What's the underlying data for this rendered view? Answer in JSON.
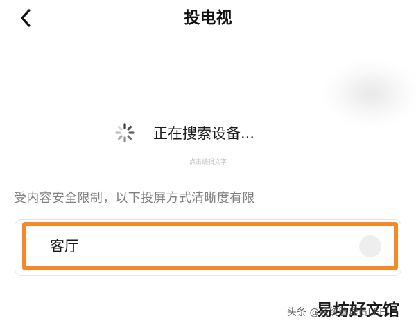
{
  "header": {
    "title": "投电视",
    "back_icon": "chevron-left-icon"
  },
  "search": {
    "status_text": "正在搜索设备...",
    "edit_hint": "点击编辑文字",
    "spinner_icon": "loading-spinner-icon"
  },
  "notice": "受内容安全限制，以下投屏方式清晰度有限",
  "devices": [
    {
      "name": "客厅",
      "selected": false
    }
  ],
  "colors": {
    "highlight": "#f5892a",
    "notice_text": "#7f7f7f",
    "card_border": "#e6e6e6"
  },
  "watermark": {
    "source": "头条 @系统管理员LEE",
    "site": "易坊好文馆"
  }
}
